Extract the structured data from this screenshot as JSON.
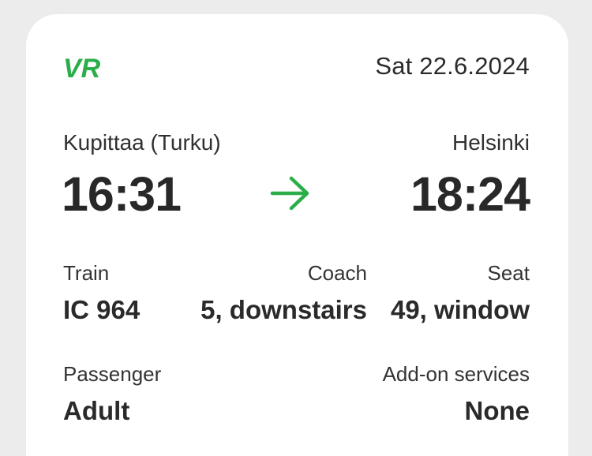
{
  "ticket": {
    "brand": "VR",
    "date": "Sat 22.6.2024",
    "accent_color": "#2bae4a",
    "departure": {
      "station": "Kupittaa (Turku)",
      "time": "16:31"
    },
    "arrival": {
      "station": "Helsinki",
      "time": "18:24"
    },
    "direction_icon": "arrow-right-icon",
    "details": {
      "train_label": "Train",
      "train_value": "IC 964",
      "coach_label": "Coach",
      "coach_value": "5, downstairs",
      "seat_label": "Seat",
      "seat_value": "49, window"
    },
    "passenger_label": "Passenger",
    "passenger_value": "Adult",
    "addon_label": "Add-on services",
    "addon_value": "None"
  }
}
